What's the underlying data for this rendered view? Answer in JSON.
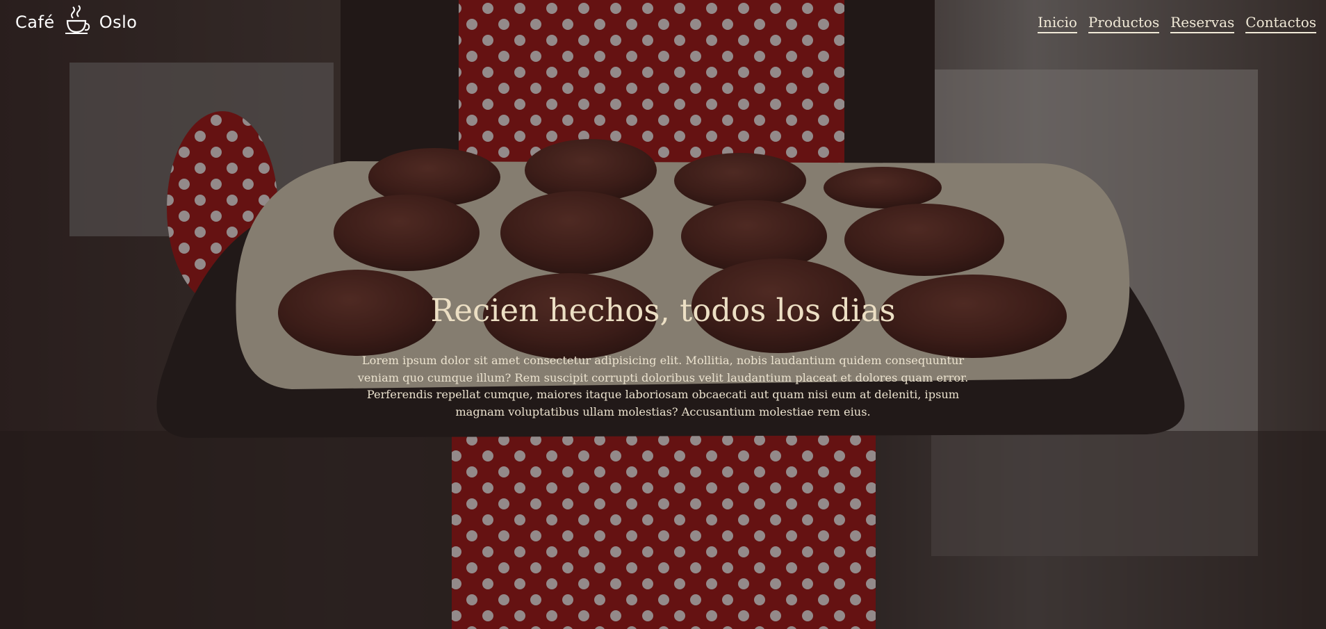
{
  "brand": {
    "name_left": "Café",
    "name_right": "Oslo",
    "logo_icon": "coffee-cup-icon"
  },
  "nav": {
    "items": [
      "Inicio",
      "Productos",
      "Reservas",
      "Contactos"
    ]
  },
  "hero": {
    "title": "Recien hechos, todos los dias",
    "text": "Lorem ipsum dolor sit amet consectetur adipisicing elit. Mollitia, nobis laudantium quidem consequuntur veniam quo cumque illum? Rem suscipit corrupti doloribus velit laudantium placeat et dolores quam error. Perferendis repellat cumque, maiores itaque laboriosam obcaecati aut quam nisi eum at deleniti, ipsum magnam voluptatibus ullam molestias? Accusantium molestiae rem eius."
  },
  "colors": {
    "nav_text": "#f1ead8",
    "title": "#ecdfc4",
    "overlay": "rgba(20,12,12,0.42)"
  }
}
